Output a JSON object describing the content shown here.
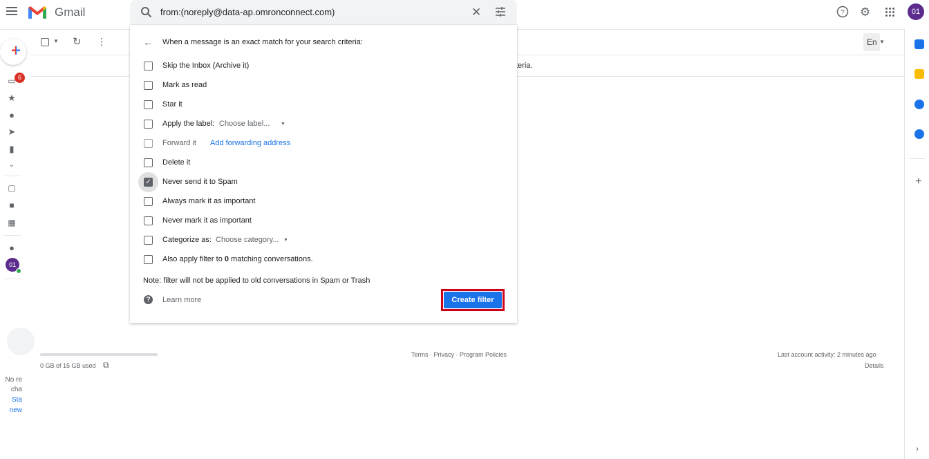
{
  "app": {
    "name": "Gmail"
  },
  "search": {
    "query": "from:(noreply@data-ap.omronconnect.com)"
  },
  "header": {
    "avatar_initials": "01"
  },
  "rail": {
    "inbox_badge": "6",
    "avatar_initials": "01",
    "chat_empty_lines": [
      "No re",
      "cha"
    ],
    "chat_start_lines": [
      "Sta",
      "new"
    ]
  },
  "toolbar": {
    "language_button": "En"
  },
  "background": {
    "criteria_tail": "teria."
  },
  "filter": {
    "heading": "When a message is an exact match for your search criteria:",
    "options": [
      {
        "label": "Skip the Inbox (Archive it)",
        "checked": false
      },
      {
        "label": "Mark as read",
        "checked": false
      },
      {
        "label": "Star it",
        "checked": false
      },
      {
        "label": "Apply the label:",
        "checked": false
      },
      {
        "label": "Forward it",
        "checked": false
      },
      {
        "label": "Delete it",
        "checked": false
      },
      {
        "label": "Never send it to Spam",
        "checked": true
      },
      {
        "label": "Always mark it as important",
        "checked": false
      },
      {
        "label": "Never mark it as important",
        "checked": false
      },
      {
        "label": "Categorize as:",
        "checked": false
      }
    ],
    "label_select": "Choose label...",
    "category_select": "Choose category...",
    "forward_link": "Add forwarding address",
    "also_apply_prefix": "Also apply filter to ",
    "also_apply_count": "0",
    "also_apply_suffix": " matching conversations.",
    "note": "Note: filter will not be applied to old conversations in Spam or Trash",
    "learn_more": "Learn more",
    "create_button": "Create filter"
  },
  "footer": {
    "storage": "0 GB of 15 GB used",
    "links": "Terms · Privacy · Program Policies",
    "activity": "Last account activity: 2 minutes ago",
    "details": "Details"
  },
  "colors": {
    "accent": "#1a73e8",
    "highlight_border": "#d0021b",
    "avatar": "#5b2c8e",
    "badge": "#d93025"
  }
}
